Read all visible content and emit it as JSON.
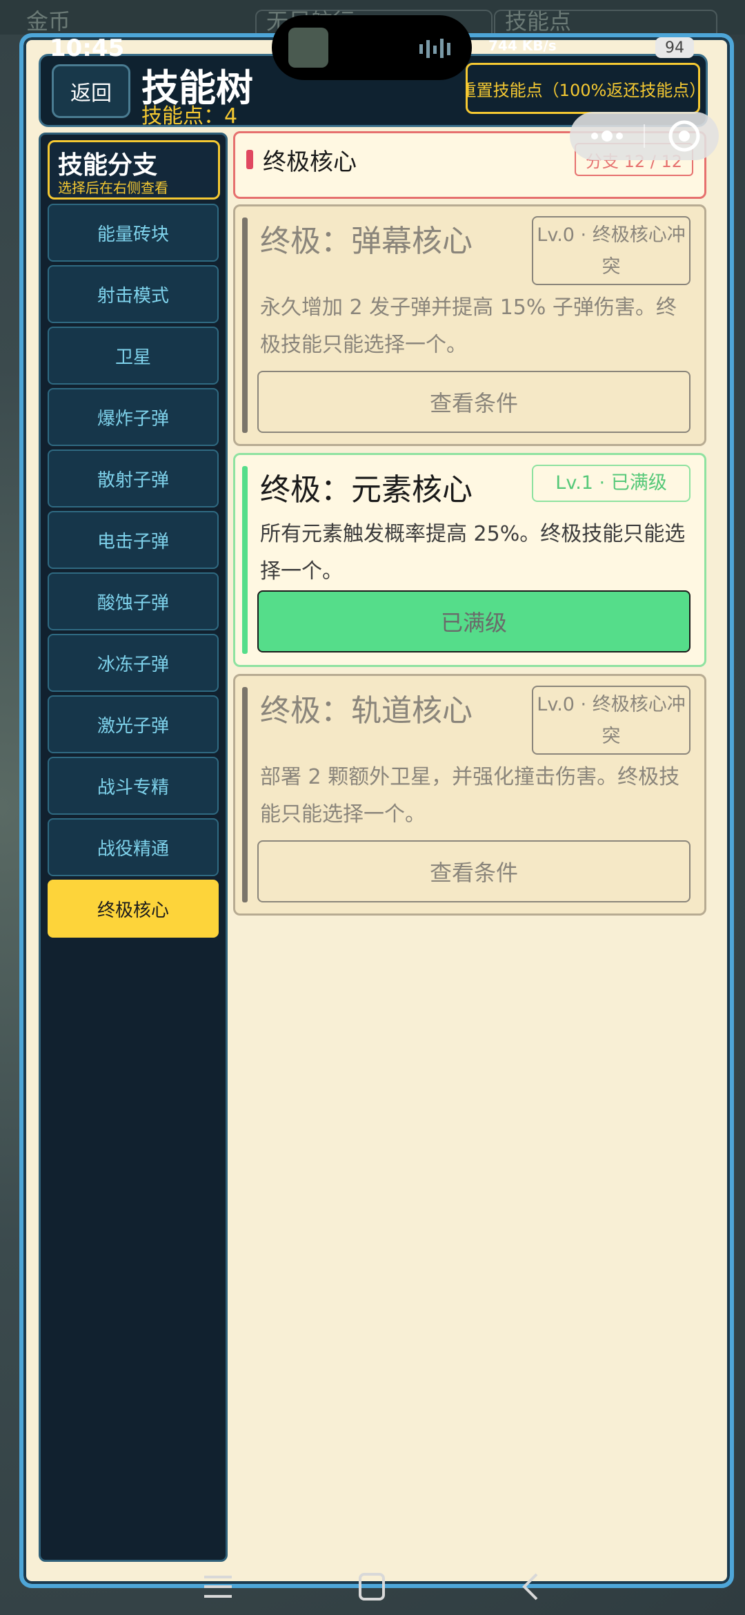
{
  "status_bar": {
    "time": "10:45",
    "net_speed": "744 KB/s",
    "battery": "94"
  },
  "background": {
    "labels": [
      "金币",
      "无尽航行",
      "技能点"
    ]
  },
  "header": {
    "back_label": "返回",
    "title": "技能树",
    "points_label": "技能点：4",
    "reset_label": "重置技能点（100%返还技能点）"
  },
  "sidebar": {
    "title": "技能分支",
    "subtitle": "选择后在右侧查看",
    "items": [
      {
        "label": "能量砖块"
      },
      {
        "label": "射击模式"
      },
      {
        "label": "卫星"
      },
      {
        "label": "爆炸子弹"
      },
      {
        "label": "散射子弹"
      },
      {
        "label": "电击子弹"
      },
      {
        "label": "酸蚀子弹"
      },
      {
        "label": "冰冻子弹"
      },
      {
        "label": "激光子弹"
      },
      {
        "label": "战斗专精"
      },
      {
        "label": "战役精通"
      },
      {
        "label": "终极核心"
      }
    ]
  },
  "branch": {
    "title": "终极核心",
    "count": "分支 12 / 12"
  },
  "cards": [
    {
      "title": "终极：弹幕核心",
      "level": "Lv.0 · 终极核心冲突",
      "desc": "永久增加 2 发子弹并提高 15% 子弹伤害。终极技能只能选择一个。",
      "button": "查看条件"
    },
    {
      "title": "终极：元素核心",
      "level": "Lv.1 · 已满级",
      "desc": "所有元素触发概率提高 25%。终极技能只能选择一个。",
      "button": "已满级"
    },
    {
      "title": "终极：轨道核心",
      "level": "Lv.0 · 终极核心冲突",
      "desc": "部署 2 颗额外卫星，并强化撞击伤害。终极技能只能选择一个。",
      "button": "查看条件"
    }
  ]
}
